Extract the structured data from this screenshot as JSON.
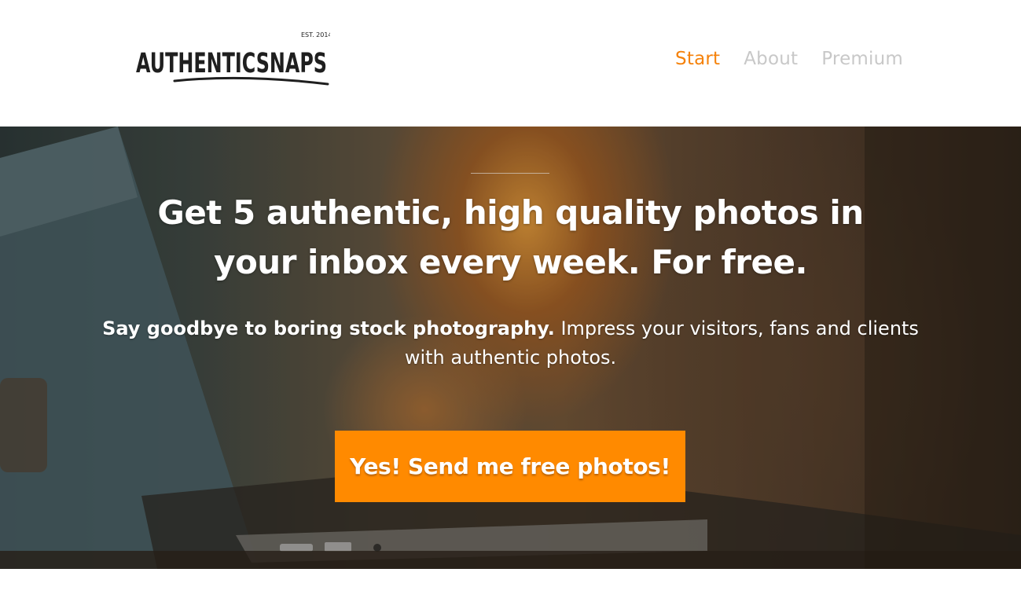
{
  "brand": {
    "name": "AuthenticSnaps",
    "logo_est": "EST. 2014",
    "logo_text": "AUTHENTICSNAPS"
  },
  "nav": {
    "items": [
      {
        "label": "Start",
        "active": true
      },
      {
        "label": "About",
        "active": false
      },
      {
        "label": "Premium",
        "active": false
      }
    ]
  },
  "hero": {
    "headline": "Get 5 authentic, high quality photos in your inbox every week. For free.",
    "sub_bold": "Say goodbye to boring stock photography.",
    "sub_rest": " Impress your visitors, fans and clients with authentic photos.",
    "cta_label": "Yes! Send me free photos!"
  },
  "colors": {
    "accent": "#f5820b",
    "cta": "#ff8a00",
    "nav_inactive": "#c8c8c8",
    "text_on_hero": "#ffffff"
  }
}
